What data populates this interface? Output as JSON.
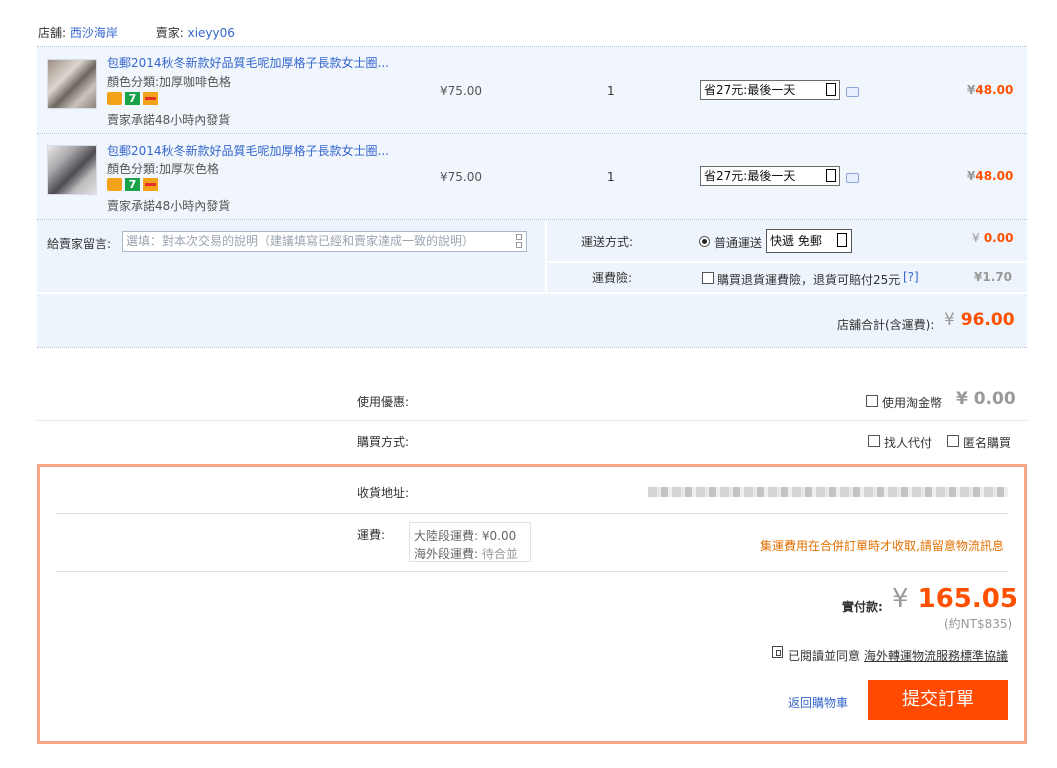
{
  "shop": {
    "store_label": "店舖:",
    "store_name": "西沙海岸",
    "seller_label": "賣家:",
    "seller_name": "xieyy06"
  },
  "items": [
    {
      "title": "包郵2014秋冬新款好品質毛呢加厚格子長款女士圈...",
      "variant": "顏色分類:加厚咖啡色格",
      "promise": "賣家承諾48小時內發貨",
      "price": "¥75.00",
      "qty": "1",
      "promo": "省27元:最後一天",
      "subtotal_currency": "¥",
      "subtotal": "48.00"
    },
    {
      "title": "包郵2014秋冬新款好品質毛呢加厚格子長款女士圈...",
      "variant": "顏色分類:加厚灰色格",
      "promise": "賣家承諾48小時內發貨",
      "price": "¥75.00",
      "qty": "1",
      "promo": "省27元:最後一天",
      "subtotal_currency": "¥",
      "subtotal": "48.00"
    }
  ],
  "message": {
    "label": "給賣家留言:",
    "placeholder": "選填：對本次交易的說明（建議填寫已經和賣家達成一致的說明）"
  },
  "shipping": {
    "label": "運送方式:",
    "option": "普通運送",
    "select_value": "快遞 免郵",
    "price_currency": "¥",
    "price": "0.00"
  },
  "insurance": {
    "label": "運費險:",
    "text": "購買退貨運費險，退貨可賠付25元",
    "help": "[?]",
    "price": "¥1.70"
  },
  "shop_total": {
    "label": "店舖合計(含運費):",
    "currency": "¥",
    "value": "96.00"
  },
  "discount": {
    "label": "使用優惠:",
    "coin_label": "使用淘金幣",
    "currency": "¥",
    "value": "0.00"
  },
  "purchase_method": {
    "label": "購買方式:",
    "proxy": "找人代付",
    "anonymous": "匿名購買"
  },
  "address": {
    "label": "收貨地址:"
  },
  "freight": {
    "label": "運費:",
    "mainland_label": "大陸段運費:",
    "mainland_value": "¥0.00",
    "overseas_label": "海外段運費:",
    "overseas_value": "待合並",
    "notice": "集運費用在合併訂單時才收取,請留意物流訊息"
  },
  "payment": {
    "label": "實付款:",
    "currency": "¥",
    "value": "165.05",
    "approx": "(約NT$835)"
  },
  "agreement": {
    "text": "已閱讀並同意",
    "link": "海外轉運物流服務標準協議"
  },
  "actions": {
    "back": "返回購物車",
    "submit": "提交訂單"
  }
}
